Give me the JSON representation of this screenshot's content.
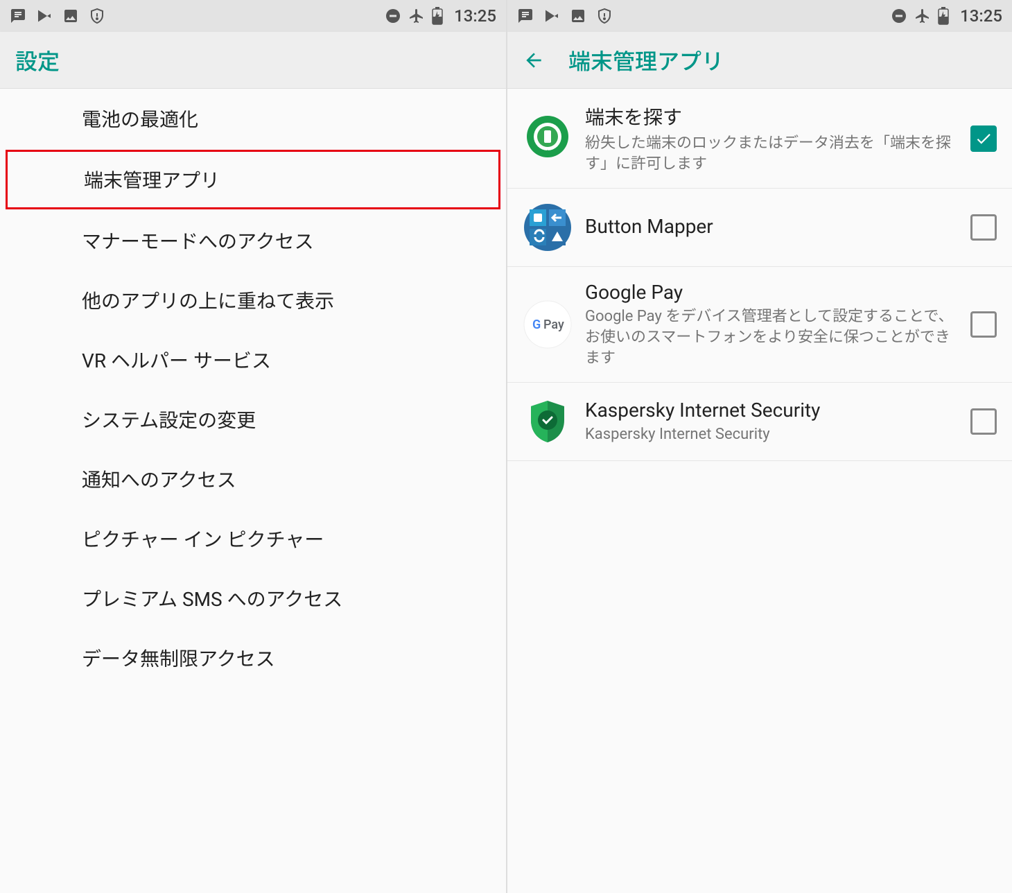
{
  "status": {
    "time": "13:25"
  },
  "left": {
    "title": "設定",
    "items": [
      {
        "label": "電池の最適化",
        "highlighted": false
      },
      {
        "label": "端末管理アプリ",
        "highlighted": true
      },
      {
        "label": "マナーモードへのアクセス",
        "highlighted": false
      },
      {
        "label": "他のアプリの上に重ねて表示",
        "highlighted": false
      },
      {
        "label": "VR ヘルパー サービス",
        "highlighted": false
      },
      {
        "label": "システム設定の変更",
        "highlighted": false
      },
      {
        "label": "通知へのアクセス",
        "highlighted": false
      },
      {
        "label": "ピクチャー イン ピクチャー",
        "highlighted": false
      },
      {
        "label": "プレミアム SMS へのアクセス",
        "highlighted": false
      },
      {
        "label": "データ無制限アクセス",
        "highlighted": false
      }
    ]
  },
  "right": {
    "title": "端末管理アプリ",
    "apps": [
      {
        "title": "端末を探す",
        "desc": "紛失した端末のロックまたはデータ消去を「端末を探す」に許可します",
        "checked": true
      },
      {
        "title": "Button Mapper",
        "desc": "",
        "checked": false
      },
      {
        "title": "Google Pay",
        "desc": "Google Pay をデバイス管理者として設定することで、お使いのスマートフォンをより安全に保つことができます",
        "checked": false
      },
      {
        "title": "Kaspersky Internet Security",
        "desc": "Kaspersky Internet Security",
        "checked": false
      }
    ]
  }
}
